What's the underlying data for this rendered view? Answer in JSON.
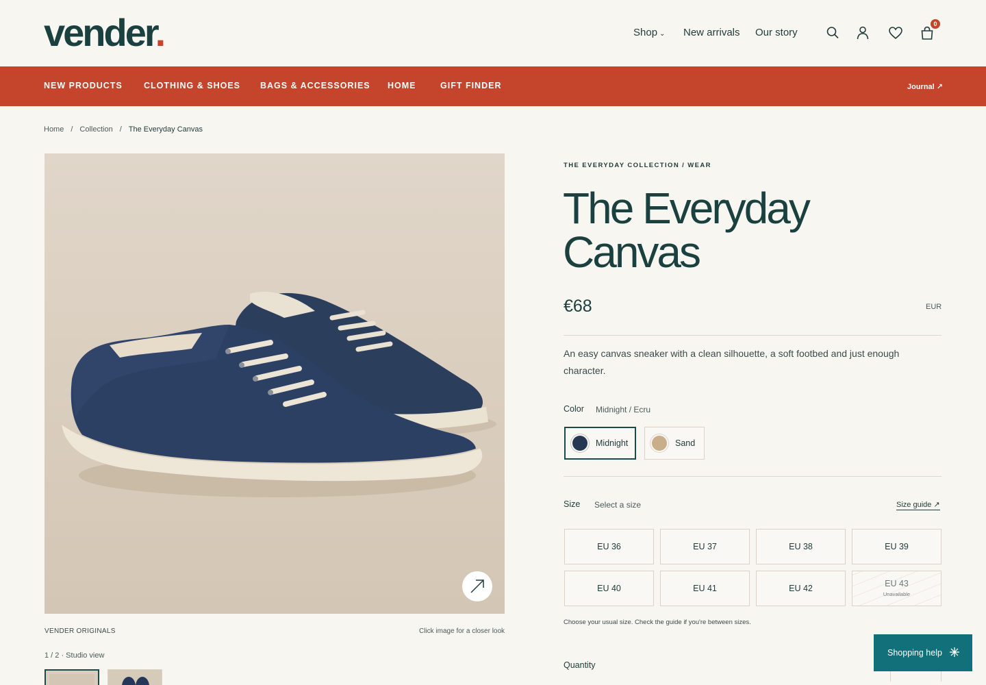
{
  "brand": {
    "name": "vender",
    "dot": "."
  },
  "topnav": {
    "shop": "Shop",
    "new_arrivals": "New arrivals",
    "our_story": "Our story",
    "cart_count": "0"
  },
  "icons": [
    "search-icon",
    "account-icon",
    "heart-icon",
    "bag-icon",
    "chevron-down-icon",
    "arrow-up-right-icon",
    "sparkle-icon"
  ],
  "categories": [
    "NEW PRODUCTS",
    "CLOTHING & SHOES",
    "BAGS & ACCESSORIES",
    "HOME",
    "GIFT FINDER"
  ],
  "journal": "Journal ↗",
  "breadcrumb": {
    "home": "Home",
    "sep": "/",
    "collection": "Collection",
    "current": "The Everyday Canvas"
  },
  "gallery": {
    "caption_left": "VENDER ORIGINALS",
    "caption_right": "Click image for a closer look",
    "count": "1 / 2 · Studio view"
  },
  "product": {
    "collection": "THE EVERYDAY COLLECTION / WEAR",
    "title": "The Everyday Canvas",
    "price": "€68",
    "currency": "EUR",
    "description": "An easy canvas sneaker with a clean silhouette, a soft footbed and just enough character."
  },
  "color": {
    "label": "Color",
    "value": "Midnight / Ecru",
    "options": [
      {
        "name": "Midnight",
        "swatch": "#253753"
      },
      {
        "name": "Sand",
        "swatch": "#c9ae8a"
      }
    ]
  },
  "size": {
    "label": "Size",
    "value": "Select a size",
    "guide": "Size guide ↗",
    "options": [
      "EU 36",
      "EU 37",
      "EU 38",
      "EU 39",
      "EU 40",
      "EU 41",
      "EU 42",
      "EU 43"
    ],
    "unavailable_label": "Unavailable",
    "note": "Choose your usual size. Check the guide if you're between sizes."
  },
  "quantity": {
    "label": "Quantity"
  },
  "help": {
    "label": "Shopping help"
  },
  "colors": {
    "accent": "#c4442c",
    "brand": "#1a4040",
    "help": "#12707a",
    "background": "#f8f6f1"
  }
}
